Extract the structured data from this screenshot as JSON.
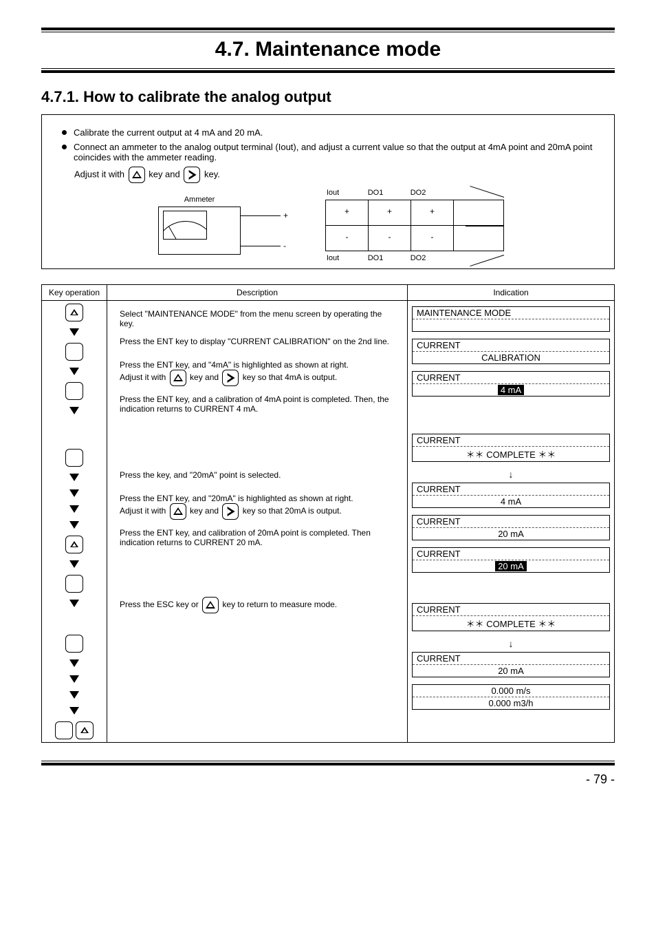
{
  "header": {
    "title": "4.7. Maintenance mode"
  },
  "section": {
    "heading": "4.7.1. How to calibrate the analog output"
  },
  "desc": {
    "line1_a": "Calibrate the current output at ",
    "line1_b": " mA and ",
    "line1_c": " mA.",
    "val4": "4",
    "val20": "20",
    "line2_a": " Connect an ammeter to the analog output terminal (Iout), and adjust a current value so that the output at 4mA point and 20mA point coincides with the ammeter reading.",
    "adjust_prefix": "Adjust it with  ",
    "adjust_mid": " key and ",
    "adjust_suffix": " key.",
    "ammeter": "Ammeter",
    "iout": "Iout",
    "do1": "DO1",
    "do2": "DO2",
    "plus": "+",
    "minus": "-"
  },
  "table": {
    "h_key": "Key operation",
    "h_op": "Description",
    "h_disp": "Indication",
    "op1": "Select \"MAINTENANCE MODE\" from the menu screen by operating the      key.",
    "op2": "Press the ENT key to display \"CURRENT CALIBRATION\" on the 2nd line.",
    "op3_a": "Press the ENT key, and \"4mA\" is highlighted as shown at right.",
    "op3_b": "Adjust it with  ",
    "op3_c": " key and ",
    "op3_d": " key so that 4mA is output.",
    "op4_a": "Press the ENT key, and a calibration of 4mA point is completed. Then, the indication returns to CURRENT 4 mA.",
    "op5": "Press the      key, and \"20mA\" point is selected.",
    "op6_a": "Press the ENT key, and \"20mA\" is highlighted as shown at right.",
    "op6_b": "Adjust it with  ",
    "op6_c": " key and ",
    "op6_d": " key so that 20mA is output.",
    "op7": "Press the ENT key, and calibration of 20mA point is completed. Then indication returns to CURRENT 20 mA.",
    "op8": "Press the ESC key or      key to return to measure mode."
  },
  "lcd": {
    "maint": "MAINTENANCE  MODE",
    "current": "CURRENT",
    "calib": "CALIBRATION",
    "ma4": "4  mA",
    "ma20": "20  mA",
    "complete": "＊＊  COMPLETE  ＊＊",
    "meas1": "0.000     m/s",
    "meas2": "0.000    m3/h"
  },
  "page": "- 79 -"
}
